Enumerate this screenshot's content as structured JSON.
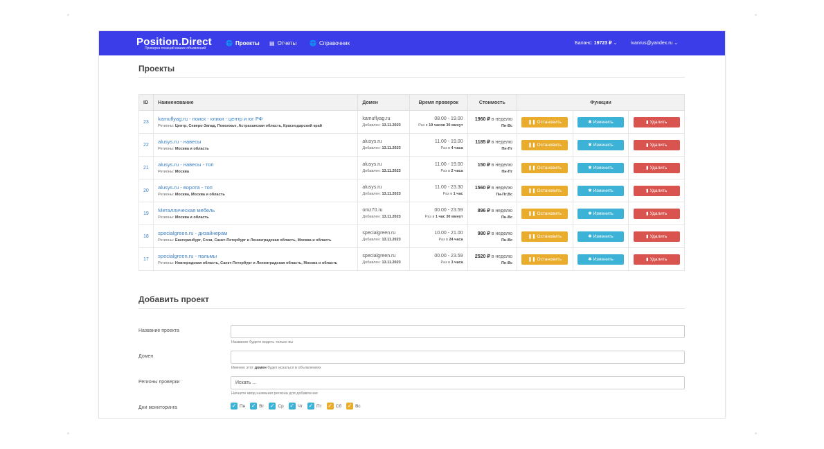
{
  "navbar": {
    "brand": "Position.Direct",
    "brand_sub": "Проверка позиций ваших объявлений",
    "items": [
      {
        "label": "Проекты",
        "icon": "globe-icon"
      },
      {
        "label": "Отчеты",
        "icon": "list-icon"
      },
      {
        "label": "Справочник",
        "icon": "globe-icon"
      }
    ],
    "balance_label": "Баланс:",
    "balance_value": "19723 ₽",
    "user": "ivanrus@yandex.ru",
    "accent": "#3b3ee8"
  },
  "projects": {
    "title": "Проекты",
    "columns": [
      "ID",
      "Наименование",
      "Домен",
      "Время проверок",
      "Стоимость",
      "Функции"
    ],
    "rows": [
      {
        "id": "23",
        "name": "kamuflyag.ru - поиск - клики - центр и юг РФ",
        "regions_label": "Регионы:",
        "regions": "Центр, Северо-Запад, Поволжье, Астраханская область, Краснодарский край",
        "domain": "kamuflyag.ru",
        "added_label": "Добавлен:",
        "added": "13.11.2023",
        "time": "08.00 - 19.00",
        "freq_label": "Раз в",
        "freq": "19 часов 30 минут",
        "cost": "1960 ₽",
        "cost_unit": "в неделю",
        "days": "Пн-Вс"
      },
      {
        "id": "22",
        "name": "alusys.ru - навесы",
        "regions_label": "Регионы:",
        "regions": "Москва и область",
        "domain": "alusys.ru",
        "added_label": "Добавлен:",
        "added": "13.11.2023",
        "time": "11.00 - 19.00",
        "freq_label": "Раз в",
        "freq": "4 часа",
        "cost": "1185 ₽",
        "cost_unit": "в неделю",
        "days": "Пн-Пт"
      },
      {
        "id": "21",
        "name": "alusys.ru - навесы - топ",
        "regions_label": "Регионы:",
        "regions": "Москва",
        "domain": "alusys.ru",
        "added_label": "Добавлен:",
        "added": "13.11.2023",
        "time": "11.00 - 19.00",
        "freq_label": "Раз в",
        "freq": "2 часа",
        "cost": "150 ₽",
        "cost_unit": "в неделю",
        "days": "Пн-Пт"
      },
      {
        "id": "20",
        "name": "alusys.ru - ворота - топ",
        "regions_label": "Регионы:",
        "regions": "Москва, Москва и область",
        "domain": "alusys.ru",
        "added_label": "Добавлен:",
        "added": "13.11.2023",
        "time": "11.00 - 23.30",
        "freq_label": "Раз в",
        "freq": "1 час",
        "cost": "1560 ₽",
        "cost_unit": "в неделю",
        "days": "Пн-Пт,Вс"
      },
      {
        "id": "19",
        "name": "Металлическая мебель",
        "regions_label": "Регионы:",
        "regions": "Москва и область",
        "domain": "omz70.ru",
        "added_label": "Добавлен:",
        "added": "13.11.2023",
        "time": "00.00 - 23.59",
        "freq_label": "Раз в",
        "freq": "1 час 30 минут",
        "cost": "896 ₽",
        "cost_unit": "в неделю",
        "days": "Пн-Вс"
      },
      {
        "id": "18",
        "name": "specialgreen.ru - дизайнерам",
        "regions_label": "Регионы:",
        "regions": "Екатеринбург, Сочи, Санкт-Петербург и Ленинградская область, Москва и область",
        "domain": "specialgreen.ru",
        "added_label": "Добавлен:",
        "added": "13.11.2023",
        "time": "10.00 - 21.00",
        "freq_label": "Раз в",
        "freq": "24 часа",
        "cost": "980 ₽",
        "cost_unit": "в неделю",
        "days": "Пн-Вс"
      },
      {
        "id": "17",
        "name": "specialgreen.ru - пальмы",
        "regions_label": "Регионы:",
        "regions": "Новгородская область, Санкт-Петербург и Ленинградская область, Москва и область",
        "domain": "specialgreen.ru",
        "added_label": "Добавлен:",
        "added": "13.11.2023",
        "time": "00.00 - 23.59",
        "freq_label": "Раз в",
        "freq": "3 часа",
        "cost": "2520 ₽",
        "cost_unit": "в неделю",
        "days": "Пн-Вс"
      }
    ],
    "buttons": {
      "stop": "Остановить",
      "edit": "Изменить",
      "delete": "Удалить"
    },
    "button_colors": {
      "stop": "#e9ac2c",
      "edit": "#3cb2d6",
      "delete": "#d9534f"
    }
  },
  "add_project": {
    "title": "Добавить проект",
    "name_label": "Название проекта",
    "name_value": "",
    "name_help": "Название будете видеть только вы",
    "domain_label": "Домен",
    "domain_value": "",
    "domain_help_pre": "Именно этот",
    "domain_help_bold": "домен",
    "domain_help_post": "будет искаться в объявлениях",
    "regions_label": "Регионы проверки",
    "regions_placeholder": "Искать ...",
    "regions_help": "Начните ввод названия региона для добавления",
    "days_label": "Дни мониторинга",
    "days": [
      {
        "label": "Пн",
        "checked": true,
        "color": "blue"
      },
      {
        "label": "Вт",
        "checked": true,
        "color": "blue"
      },
      {
        "label": "Ср",
        "checked": true,
        "color": "blue"
      },
      {
        "label": "Чт",
        "checked": true,
        "color": "blue"
      },
      {
        "label": "Пт",
        "checked": true,
        "color": "blue"
      },
      {
        "label": "Сб",
        "checked": true,
        "color": "yellow"
      },
      {
        "label": "Вс",
        "checked": true,
        "color": "yellow"
      }
    ]
  }
}
